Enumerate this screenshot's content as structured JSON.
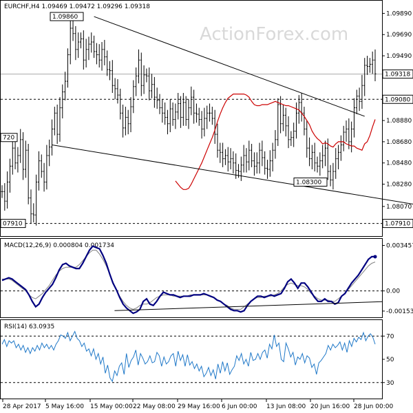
{
  "watermark": "ActionForex.com",
  "colors": {
    "price": "#000000",
    "sma": "#cc0000",
    "macd": "#000080",
    "signal": "#808080",
    "rsi": "#1f78c8",
    "grid": "#000000"
  },
  "chart_data": [
    {
      "type": "line",
      "panel": "price",
      "header": "EURCHF,H4  1.09469 1.09472 1.09296 1.09318",
      "y_ticks": [
        "1.09890",
        "1.09690",
        "1.09490",
        "1.09080",
        "1.08880",
        "1.08680",
        "1.08480",
        "1.08280",
        "1.08070",
        "1.07910"
      ],
      "ylim": [
        1.0781,
        1.0999
      ],
      "current_price": "1.09318",
      "annotations": [
        {
          "text": "1.09860",
          "value": 1.0986
        },
        {
          "text": "1.08300",
          "value": 1.083
        },
        {
          "text": "720",
          "value": 1.0872
        },
        {
          "text": "07910",
          "value": 1.0791
        }
      ],
      "horizontal_levels": [
        1.0908,
        1.0791
      ],
      "horizontal_level_labels": [
        "1.09080",
        "1.07910"
      ],
      "close": [
        1.0821,
        1.0812,
        1.083,
        1.0845,
        1.0862,
        1.0848,
        1.0855,
        1.087,
        1.0842,
        1.086,
        1.0815,
        1.08,
        1.0799,
        1.083,
        1.085,
        1.084,
        1.083,
        1.0855,
        1.0863,
        1.088,
        1.0895,
        1.0875,
        1.09,
        1.0915,
        1.0925,
        1.095,
        1.0975,
        1.097,
        1.0955,
        1.0962,
        1.0965,
        1.0945,
        1.0955,
        1.096,
        1.0962,
        1.0953,
        1.095,
        1.0945,
        1.0955,
        1.0948,
        1.0936,
        1.0935,
        1.0921,
        1.0918,
        1.0912,
        1.0895,
        1.0881,
        1.0891,
        1.0885,
        1.0901,
        1.092,
        1.093,
        1.0945,
        1.0921,
        1.0931,
        1.093,
        1.0916,
        1.0922,
        1.091,
        1.0907,
        1.09,
        1.0895,
        1.0891,
        1.0885,
        1.0899,
        1.0889,
        1.0896,
        1.0904,
        1.0891,
        1.0905,
        1.0889,
        1.09,
        1.091,
        1.0895,
        1.0894,
        1.0889,
        1.088,
        1.089,
        1.0895,
        1.0895,
        1.089,
        1.0875,
        1.086,
        1.0858,
        1.0852,
        1.0855,
        1.0849,
        1.0852,
        1.0848,
        1.0841,
        1.084,
        1.0846,
        1.0855,
        1.0849,
        1.086,
        1.085,
        1.0845,
        1.0848,
        1.086,
        1.0853,
        1.0843,
        1.0842,
        1.085,
        1.086,
        1.087,
        1.0903,
        1.0885,
        1.0893,
        1.0883,
        1.087,
        1.0872,
        1.0878,
        1.0895,
        1.0905,
        1.0895,
        1.088,
        1.0862,
        1.0852,
        1.0858,
        1.0848,
        1.0845,
        1.085,
        1.0855,
        1.0862,
        1.084,
        1.0832,
        1.084,
        1.0852,
        1.0858,
        1.0865,
        1.0877,
        1.088,
        1.0868,
        1.088,
        1.09,
        1.0911,
        1.0906,
        1.0921,
        1.094,
        1.0939,
        1.0941,
        1.0945,
        1.0932
      ],
      "sma": [
        1.0831,
        1.0828,
        1.0825,
        1.0823,
        1.0823,
        1.0824,
        1.0828,
        1.0833,
        1.0838,
        1.0843,
        1.0848,
        1.0854,
        1.086,
        1.0866,
        1.0872,
        1.0879,
        1.0887,
        1.0894,
        1.09,
        1.0905,
        1.0909,
        1.0911,
        1.0913,
        1.0913,
        1.0913,
        1.0913,
        1.0913,
        1.0912,
        1.091,
        1.0906,
        1.0903,
        1.0902,
        1.0902,
        1.0903,
        1.0903,
        1.0903,
        1.0904,
        1.0905,
        1.0906,
        1.0905,
        1.0904,
        1.0903,
        1.0902,
        1.0902,
        1.0901,
        1.09,
        1.0899,
        1.0898,
        1.0895,
        1.0892,
        1.0888,
        1.0884,
        1.0878,
        1.0874,
        1.0871,
        1.0869,
        1.0866,
        1.0867,
        1.0866,
        1.0864,
        1.0863,
        1.0866,
        1.0868,
        1.0868,
        1.0868,
        1.0866,
        1.0865,
        1.0864,
        1.0864,
        1.0862,
        1.0861,
        1.086,
        1.0866,
        1.0868,
        1.0874,
        1.0882,
        1.0889
      ],
      "sma_period": 55,
      "sma_offset": 66,
      "trendlines": [
        {
          "x": [
            35,
            138
          ],
          "y": [
            1.0986,
            1.0892
          ]
        },
        {
          "x": [
            19,
            157
          ],
          "y": [
            1.0865,
            1.0809
          ]
        }
      ]
    },
    {
      "type": "line",
      "panel": "macd",
      "header": "MACD(12,26,9) 0.000804 0.001734",
      "y_ticks": [
        "0.003457",
        "0.00",
        "-0.001532"
      ],
      "ylim": [
        -0.00185,
        0.0038
      ],
      "zero_line": 0,
      "macd": [
        0.0008,
        0.0009,
        0.001,
        0.0009,
        0.0007,
        0.0005,
        0.0003,
        0.0001,
        -0.0003,
        -0.0008,
        -0.0012,
        -0.001,
        -0.0005,
        -0.0001,
        0.0002,
        0.0005,
        0.001,
        0.0016,
        0.002,
        0.0021,
        0.0019,
        0.0018,
        0.0017,
        0.0017,
        0.0021,
        0.0026,
        0.0031,
        0.0034,
        0.0033,
        0.0032,
        0.0027,
        0.0021,
        0.0013,
        0.0006,
        0.0001,
        -0.0005,
        -0.001,
        -0.0013,
        -0.0015,
        -0.0017,
        -0.0016,
        -0.0014,
        -0.0008,
        -0.0006,
        -0.001,
        -0.0011,
        -0.0008,
        -0.0004,
        -0.0001,
        -0.0002,
        -0.0003,
        -0.0003,
        -0.0004,
        -0.0005,
        -0.0004,
        -0.0004,
        -0.0004,
        -0.0003,
        -0.0003,
        -0.0003,
        -0.0002,
        -0.0003,
        -0.0004,
        -0.0005,
        -0.0007,
        -0.0008,
        -0.001,
        -0.0012,
        -0.0014,
        -0.0015,
        -0.0015,
        -0.0016,
        -0.0015,
        -0.0011,
        -0.0008,
        -0.0006,
        -0.0004,
        -0.0004,
        -0.0005,
        -0.0004,
        -0.0003,
        -0.0004,
        -0.0003,
        -0.0002,
        0.0002,
        0.0007,
        0.0009,
        0.0006,
        0.0002,
        0.0006,
        0.0006,
        0.0003,
        -0.0001,
        -0.0005,
        -0.0008,
        -0.0008,
        -0.0006,
        -0.0008,
        -0.0008,
        -0.001,
        -0.0009,
        -0.0004,
        -0.0002,
        0.0002,
        0.0006,
        0.0009,
        0.0012,
        0.0016,
        0.002,
        0.0024,
        0.0026,
        0.0026
      ],
      "signal": [
        0.0009,
        0.0009,
        0.0009,
        0.0008,
        0.0006,
        0.0004,
        0.0002,
        0.0,
        -0.0003,
        -0.0005,
        -0.0006,
        -0.0004,
        -0.0002,
        0.0001,
        0.0004,
        0.0008,
        0.0012,
        0.0015,
        0.0017,
        0.0018,
        0.0018,
        0.0018,
        0.0018,
        0.002,
        0.0023,
        0.0026,
        0.0029,
        0.0031,
        0.0031,
        0.0028,
        0.0024,
        0.0019,
        0.0013,
        0.0007,
        0.0001,
        -0.0004,
        -0.0008,
        -0.0011,
        -0.0013,
        -0.0014,
        -0.0013,
        -0.0011,
        -0.001,
        -0.001,
        -0.0009,
        -0.0007,
        -0.0005,
        -0.0004,
        -0.0003,
        -0.0003,
        -0.0003,
        -0.0004,
        -0.0004,
        -0.0004,
        -0.0004,
        -0.0004,
        -0.0003,
        -0.0003,
        -0.0003,
        -0.0003,
        -0.0003,
        -0.0003,
        -0.0004,
        -0.0005,
        -0.0007,
        -0.0008,
        -0.001,
        -0.0011,
        -0.0013,
        -0.0014,
        -0.0014,
        -0.0014,
        -0.0012,
        -0.001,
        -0.0008,
        -0.0006,
        -0.0005,
        -0.0005,
        -0.0004,
        -0.0004,
        -0.0004,
        -0.0003,
        -0.0002,
        0.0,
        0.0003,
        0.0005,
        0.0006,
        0.0005,
        0.0004,
        0.0004,
        0.0003,
        0.0001,
        -0.0002,
        -0.0004,
        -0.0006,
        -0.0007,
        -0.0007,
        -0.0007,
        -0.0008,
        -0.0008,
        -0.0006,
        -0.0004,
        -0.0002,
        0.0001,
        0.0004,
        0.0007,
        0.001,
        0.0013,
        0.0016,
        0.0019,
        0.0021,
        0.0022
      ],
      "trendline": {
        "x": [
          60,
          195
        ],
        "y": [
          -0.0015,
          -0.00082
        ]
      }
    },
    {
      "type": "line",
      "panel": "rsi",
      "header": "RSI(14) 63.0935",
      "y_ticks": [
        "70",
        "50",
        "30"
      ],
      "ylim": [
        18,
        82
      ],
      "levels": [
        70,
        30
      ],
      "rsi": [
        63,
        67,
        61,
        66,
        64,
        66,
        60,
        63,
        58,
        62,
        56,
        60,
        55,
        60,
        57,
        62,
        58,
        64,
        60,
        63,
        59,
        62,
        58,
        63,
        66,
        71,
        70,
        68,
        73,
        66,
        70,
        74,
        68,
        66,
        61,
        64,
        57,
        59,
        53,
        59,
        50,
        55,
        46,
        52,
        38,
        45,
        34,
        31,
        40,
        36,
        44,
        47,
        37,
        55,
        43,
        49,
        52,
        58,
        45,
        55,
        51,
        46,
        48,
        53,
        47,
        48,
        56,
        53,
        44,
        52,
        46,
        48,
        53,
        55,
        44,
        57,
        49,
        54,
        44,
        54,
        45,
        48,
        42,
        46,
        40,
        44,
        35,
        38,
        43,
        36,
        41,
        33,
        46,
        38,
        48,
        40,
        47,
        37,
        41,
        44,
        53,
        49,
        55,
        46,
        50,
        44,
        56,
        49,
        50,
        55,
        50,
        56,
        58,
        51,
        63,
        59,
        71,
        61,
        64,
        50,
        48,
        64,
        59,
        52,
        56,
        45,
        52,
        50,
        55,
        47,
        53,
        51,
        43,
        46,
        37,
        47,
        49,
        52,
        55,
        62,
        58,
        63,
        60,
        62,
        65,
        58,
        64,
        56,
        66,
        61,
        68,
        65,
        69,
        67,
        73,
        66,
        70,
        72,
        69,
        63
      ]
    }
  ],
  "x_axis": {
    "ticks": [
      "28 Apr 2017",
      "5 May 16:00",
      "15 May 00:00",
      "22 May 08:00",
      "29 May 16:00",
      "6 Jun 00:00",
      "13 Jun 08:00",
      "20 Jun 16:00",
      "28 Jun 00:00"
    ]
  }
}
